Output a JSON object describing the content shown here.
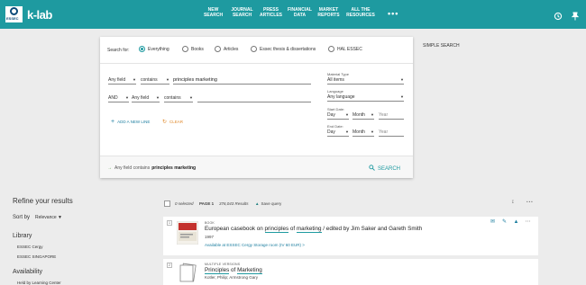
{
  "header": {
    "logo_text": "ESSEC",
    "brand": "k-lab",
    "nav": [
      {
        "line1": "NEW",
        "line2": "SEARCH"
      },
      {
        "line1": "JOURNAL",
        "line2": "SEARCH"
      },
      {
        "line1": "PRESS",
        "line2": "ARTICLES"
      },
      {
        "line1": "FINANCIAL",
        "line2": "DATA"
      },
      {
        "line1": "MARKET",
        "line2": "REPORTS"
      },
      {
        "line1": "ALL THE",
        "line2": "RESOURCES"
      }
    ],
    "more": "•••"
  },
  "search": {
    "search_for_label": "Search for:",
    "scopes": [
      "Everything",
      "Books",
      "Articles",
      "Essec thesis & dissertations",
      "HAL ESSEC"
    ],
    "row1": {
      "field": "Any field",
      "op": "contains",
      "value": "principles marketing"
    },
    "row2": {
      "bool": "AND",
      "field": "Any field",
      "op": "contains",
      "value": ""
    },
    "add_line": "ADD A NEW LINE",
    "clear": "CLEAR",
    "material_type_label": "Material Type",
    "material_type": "All items",
    "language_label": "Language",
    "language": "Any language",
    "start_date_label": "Start Date:",
    "end_date_label": "End Date:",
    "day": "Day",
    "month": "Month",
    "year_placeholder": "Year",
    "summary_field": "Any field",
    "summary_op": "contains",
    "summary_value": "principles marketing",
    "search_button": "SEARCH"
  },
  "simple_search": "SIMPLE SEARCH",
  "refine": {
    "title": "Refine your results",
    "sort_by": "Sort by",
    "sort_value": "Relevance",
    "library_title": "Library",
    "libraries": [
      "ESSEC Cergy",
      "ESSEC SINGAPORE"
    ],
    "availability_title": "Availability",
    "availability_first": "Held by Learning Center"
  },
  "results_toolbar": {
    "selected": "0 selected",
    "page": "PAGE 1",
    "count": "376,043 Results",
    "save_query": "Save query"
  },
  "results": [
    {
      "num": "1",
      "type": "BOOK",
      "title_pre": "European casebook on ",
      "title_h1": "principles",
      "title_mid": " of ",
      "title_h2": "marketing",
      "title_post": " / edited by Jim Saker and Gareth Smith",
      "year": "1997",
      "availability": "Available at ESSEC Cergy  Storage room (IV 60 EUR)  >"
    },
    {
      "num": "2",
      "type": "MULTIPLE VERSIONS",
      "title_h1": "Principles",
      "title_mid": " of ",
      "title_h2": "Marketing",
      "authors": "Kotler, Philip; Armstrong Gary"
    }
  ]
}
